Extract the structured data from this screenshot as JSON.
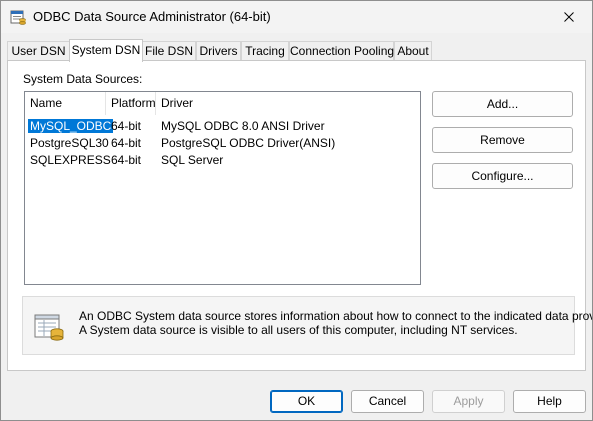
{
  "window": {
    "title": "ODBC Data Source Administrator (64-bit)",
    "app_icon": "odbc-admin-icon",
    "close_icon": "close-icon"
  },
  "tabs": [
    {
      "label": "User DSN"
    },
    {
      "label": "System DSN",
      "active": true
    },
    {
      "label": "File DSN"
    },
    {
      "label": "Drivers"
    },
    {
      "label": "Tracing"
    },
    {
      "label": "Connection Pooling"
    },
    {
      "label": "About"
    }
  ],
  "panel": {
    "section_label": "System Data Sources:",
    "columns": [
      "Name",
      "Platform",
      "Driver"
    ],
    "rows": [
      {
        "name": "MySQL_ODBC",
        "platform": "64-bit",
        "driver": "MySQL ODBC 8.0 ANSI Driver",
        "selected": true
      },
      {
        "name": "PostgreSQL30",
        "platform": "64-bit",
        "driver": "PostgreSQL ODBC Driver(ANSI)"
      },
      {
        "name": "SQLEXPRESS",
        "platform": "64-bit",
        "driver": "SQL Server"
      }
    ],
    "side_buttons": {
      "add": "Add...",
      "remove": "Remove",
      "configure": "Configure..."
    },
    "info": {
      "icon": "data-sources-icon",
      "line1": "An ODBC System data source stores information about how to connect to the indicated data provider.",
      "line2": "A System data source is visible to all users of this computer, including NT services."
    }
  },
  "footer_buttons": {
    "ok": "OK",
    "cancel": "Cancel",
    "apply": "Apply",
    "help": "Help"
  },
  "colors": {
    "selection": "#0078d7",
    "default_button_border": "#0067c0",
    "window_bg": "#f0f0f0"
  }
}
